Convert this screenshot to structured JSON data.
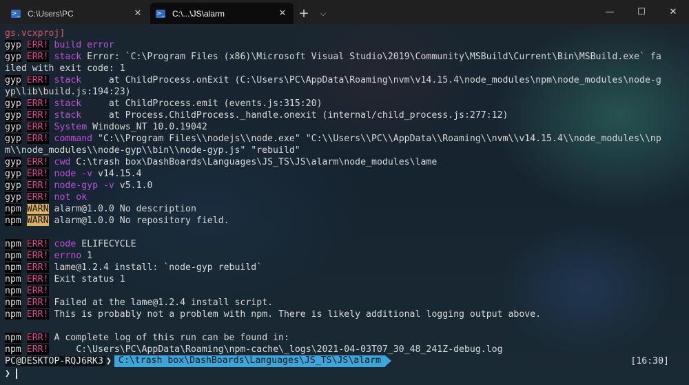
{
  "window": {
    "tabs": [
      {
        "label": "C:\\Users\\PC",
        "icon": "powershell-icon",
        "active": false
      },
      {
        "label": "C:\\...\\JS\\alarm",
        "icon": "powershell-icon",
        "active": true
      }
    ],
    "new_tab_symbol": "+",
    "dropdown_symbol": "⌵",
    "minimize_symbol": "—",
    "maximize_symbol": "☐",
    "close_symbol": "✕",
    "tab_close_symbol": "✕"
  },
  "colors": {
    "err": "#e6479f",
    "warn_bg": "#ddb25b",
    "keyword": "#c24fe0",
    "path_segment": "#3ba6dc"
  },
  "lines": [
    {
      "segs": [
        [
          "red",
          "gs.vcxproj]"
        ]
      ]
    },
    {
      "segs": [
        [
          "gyp",
          "gyp"
        ],
        [
          "t",
          " "
        ],
        [
          "err",
          "ERR!"
        ],
        [
          "t",
          " "
        ],
        [
          "kw",
          "build error"
        ]
      ]
    },
    {
      "segs": [
        [
          "gyp",
          "gyp"
        ],
        [
          "t",
          " "
        ],
        [
          "err",
          "ERR!"
        ],
        [
          "t",
          " "
        ],
        [
          "kw",
          "stack"
        ],
        [
          "t",
          " Error: `C:\\Program Files (x86)\\Microsoft Visual Studio\\2019\\Community\\MSBuild\\Current\\Bin\\MSBuild.exe` fa"
        ]
      ]
    },
    {
      "segs": [
        [
          "t",
          "iled with exit code: 1"
        ]
      ]
    },
    {
      "segs": [
        [
          "gyp",
          "gyp"
        ],
        [
          "t",
          " "
        ],
        [
          "err",
          "ERR!"
        ],
        [
          "t",
          " "
        ],
        [
          "kw",
          "stack"
        ],
        [
          "t",
          "     at ChildProcess.onExit (C:\\Users\\PC\\AppData\\Roaming\\nvm\\v14.15.4\\node_modules\\npm\\node_modules\\node-g"
        ]
      ]
    },
    {
      "segs": [
        [
          "t",
          "yp\\lib\\build.js:194:23)"
        ]
      ]
    },
    {
      "segs": [
        [
          "gyp",
          "gyp"
        ],
        [
          "t",
          " "
        ],
        [
          "err",
          "ERR!"
        ],
        [
          "t",
          " "
        ],
        [
          "kw",
          "stack"
        ],
        [
          "t",
          "     at ChildProcess.emit (events.js:315:20)"
        ]
      ]
    },
    {
      "segs": [
        [
          "gyp",
          "gyp"
        ],
        [
          "t",
          " "
        ],
        [
          "err",
          "ERR!"
        ],
        [
          "t",
          " "
        ],
        [
          "kw",
          "stack"
        ],
        [
          "t",
          "     at Process.ChildProcess._handle.onexit (internal/child_process.js:277:12)"
        ]
      ]
    },
    {
      "segs": [
        [
          "gyp",
          "gyp"
        ],
        [
          "t",
          " "
        ],
        [
          "err",
          "ERR!"
        ],
        [
          "t",
          " "
        ],
        [
          "kw",
          "System"
        ],
        [
          "t",
          " Windows_NT 10.0.19042"
        ]
      ]
    },
    {
      "segs": [
        [
          "gyp",
          "gyp"
        ],
        [
          "t",
          " "
        ],
        [
          "err",
          "ERR!"
        ],
        [
          "t",
          " "
        ],
        [
          "kw",
          "command"
        ],
        [
          "t",
          " \"C:\\\\Program Files\\\\nodejs\\\\node.exe\" \"C:\\\\Users\\\\PC\\\\AppData\\\\Roaming\\\\nvm\\\\v14.15.4\\\\node_modules\\\\np"
        ]
      ]
    },
    {
      "segs": [
        [
          "t",
          "m\\\\node_modules\\\\node-gyp\\\\bin\\\\node-gyp.js\" \"rebuild\""
        ]
      ]
    },
    {
      "segs": [
        [
          "gyp",
          "gyp"
        ],
        [
          "t",
          " "
        ],
        [
          "err",
          "ERR!"
        ],
        [
          "t",
          " "
        ],
        [
          "kw",
          "cwd"
        ],
        [
          "t",
          " C:\\trash box\\DashBoards\\Languages\\JS_TS\\JS\\alarm\\node_modules\\lame"
        ]
      ]
    },
    {
      "segs": [
        [
          "gyp",
          "gyp"
        ],
        [
          "t",
          " "
        ],
        [
          "err",
          "ERR!"
        ],
        [
          "t",
          " "
        ],
        [
          "kw",
          "node -v"
        ],
        [
          "t",
          " v14.15.4"
        ]
      ]
    },
    {
      "segs": [
        [
          "gyp",
          "gyp"
        ],
        [
          "t",
          " "
        ],
        [
          "err",
          "ERR!"
        ],
        [
          "t",
          " "
        ],
        [
          "kw",
          "node-gyp -v"
        ],
        [
          "t",
          " v5.1.0"
        ]
      ]
    },
    {
      "segs": [
        [
          "gyp",
          "gyp"
        ],
        [
          "t",
          " "
        ],
        [
          "err",
          "ERR!"
        ],
        [
          "t",
          " "
        ],
        [
          "kw",
          "not ok"
        ]
      ]
    },
    {
      "segs": [
        [
          "npm",
          "npm"
        ],
        [
          "t",
          " "
        ],
        [
          "warn",
          "WARN"
        ],
        [
          "t",
          " alarm@1.0.0 No description"
        ]
      ]
    },
    {
      "segs": [
        [
          "npm",
          "npm"
        ],
        [
          "t",
          " "
        ],
        [
          "warn",
          "WARN"
        ],
        [
          "t",
          " alarm@1.0.0 No repository field."
        ]
      ]
    },
    {
      "segs": [
        [
          "t",
          " "
        ]
      ]
    },
    {
      "segs": [
        [
          "npm",
          "npm"
        ],
        [
          "t",
          " "
        ],
        [
          "err",
          "ERR!"
        ],
        [
          "t",
          " "
        ],
        [
          "kw",
          "code"
        ],
        [
          "t",
          " ELIFECYCLE"
        ]
      ]
    },
    {
      "segs": [
        [
          "npm",
          "npm"
        ],
        [
          "t",
          " "
        ],
        [
          "err",
          "ERR!"
        ],
        [
          "t",
          " "
        ],
        [
          "kw",
          "errno"
        ],
        [
          "t",
          " 1"
        ]
      ]
    },
    {
      "segs": [
        [
          "npm",
          "npm"
        ],
        [
          "t",
          " "
        ],
        [
          "err",
          "ERR!"
        ],
        [
          "t",
          " lame@1.2.4 install: `node-gyp rebuild`"
        ]
      ]
    },
    {
      "segs": [
        [
          "npm",
          "npm"
        ],
        [
          "t",
          " "
        ],
        [
          "err",
          "ERR!"
        ],
        [
          "t",
          " Exit status 1"
        ]
      ]
    },
    {
      "segs": [
        [
          "npm",
          "npm"
        ],
        [
          "t",
          " "
        ],
        [
          "err",
          "ERR!"
        ]
      ]
    },
    {
      "segs": [
        [
          "npm",
          "npm"
        ],
        [
          "t",
          " "
        ],
        [
          "err",
          "ERR!"
        ],
        [
          "t",
          " Failed at the lame@1.2.4 install script."
        ]
      ]
    },
    {
      "segs": [
        [
          "npm",
          "npm"
        ],
        [
          "t",
          " "
        ],
        [
          "err",
          "ERR!"
        ],
        [
          "t",
          " This is probably not a problem with npm. There is likely additional logging output above."
        ]
      ]
    },
    {
      "segs": [
        [
          "t",
          " "
        ]
      ]
    },
    {
      "segs": [
        [
          "npm",
          "npm"
        ],
        [
          "t",
          " "
        ],
        [
          "err",
          "ERR!"
        ],
        [
          "t",
          " A complete log of this run can be found in:"
        ]
      ]
    },
    {
      "segs": [
        [
          "npm",
          "npm"
        ],
        [
          "t",
          " "
        ],
        [
          "err",
          "ERR!"
        ],
        [
          "t",
          "     C:\\Users\\PC\\AppData\\Roaming\\npm-cache\\_logs\\2021-04-03T07_30_48_241Z-debug.log"
        ]
      ]
    }
  ],
  "prompt": {
    "host": "PC@DESKTOP-RQJ6RK3",
    "separator": "❯",
    "path": "C:\\trash box\\DashBoards\\Languages\\JS_TS\\JS\\alarm",
    "time": "[16:30]",
    "input_symbol": "❯"
  }
}
